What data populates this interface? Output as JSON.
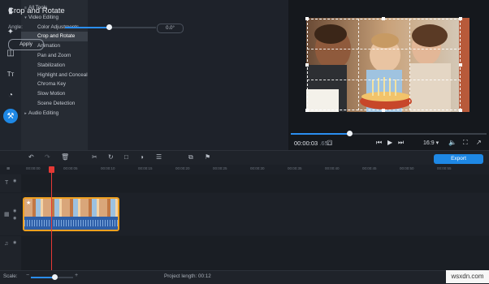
{
  "tools_panel": {
    "items": [
      {
        "label": "All Tools",
        "indent": 0,
        "arrow": "≡"
      },
      {
        "label": "Video Editing",
        "indent": 0,
        "arrow": "▾"
      },
      {
        "label": "Color Adjustments",
        "indent": 1,
        "arrow": ""
      },
      {
        "label": "Crop and Rotate",
        "indent": 1,
        "arrow": "",
        "selected": true
      },
      {
        "label": "Animation",
        "indent": 1,
        "arrow": ""
      },
      {
        "label": "Pan and Zoom",
        "indent": 1,
        "arrow": ""
      },
      {
        "label": "Stabilization",
        "indent": 1,
        "arrow": ""
      },
      {
        "label": "Highlight and Conceal",
        "indent": 1,
        "arrow": ""
      },
      {
        "label": "Chroma Key",
        "indent": 1,
        "arrow": ""
      },
      {
        "label": "Slow Motion",
        "indent": 1,
        "arrow": ""
      },
      {
        "label": "Scene Detection",
        "indent": 1,
        "arrow": ""
      },
      {
        "label": "Audio Editing",
        "indent": 0,
        "arrow": "▸"
      }
    ]
  },
  "crop_panel": {
    "title": "Crop and Rotate",
    "angle_label": "Angle:",
    "angle_value": "0.0°",
    "angle_level": 0.48,
    "apply_label": "Apply"
  },
  "player": {
    "time_current": "00:00:03",
    "time_frac": ".650",
    "aspect": "16:9 ▾",
    "progress": 0.3
  },
  "toolbar": {
    "export_label": "Export"
  },
  "ruler": {
    "ticks": [
      "00:00:00",
      "00:00:05",
      "00:00:10",
      "00:00:15",
      "00:00:20",
      "00:00:25",
      "00:00:30",
      "00:00:35",
      "00:00:40",
      "00:00:45",
      "00:00:50",
      "00:00:55"
    ]
  },
  "bottom": {
    "scale_label": "Scale:",
    "project_length": "Project length: 00:12",
    "scale_level": 0.55
  },
  "watermark": "wsxdn.com",
  "colors": {
    "accent": "#1e88e5",
    "clip_border": "#f0a020",
    "playhead": "#e53935"
  },
  "icons": {
    "rail": [
      "video-import-icon",
      "magic-wand-icon",
      "transitions-icon",
      "titles-icon",
      "stickers-icon",
      "tools-icon"
    ]
  }
}
